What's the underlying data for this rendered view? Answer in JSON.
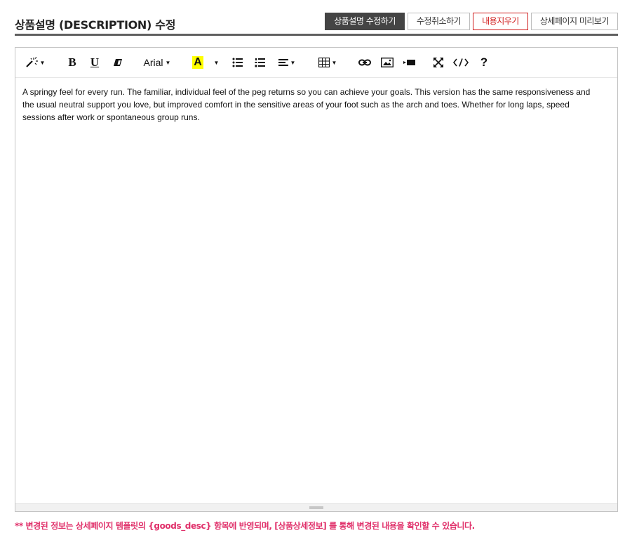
{
  "header": {
    "title": "상품설명 (DESCRIPTION) 수정",
    "buttons": {
      "save": "상품설명 수정하기",
      "cancel": "수정취소하기",
      "clear": "내용지우기",
      "preview": "상세페이지 미리보기"
    }
  },
  "toolbar": {
    "font_name": "Arial",
    "highlight_letter": "A",
    "bold": "B",
    "underline": "U",
    "help": "?",
    "icons": [
      "magic-icon",
      "bold-icon",
      "underline-icon",
      "eraser-icon",
      "font-family-dropdown",
      "font-color-icon",
      "bullet-list-icon",
      "numbered-list-icon",
      "align-icon",
      "table-icon",
      "link-icon",
      "image-icon",
      "video-icon",
      "fullscreen-icon",
      "code-view-icon",
      "help-icon"
    ],
    "highlight_color": "#ffff00"
  },
  "editor": {
    "content": "A springy feel for every run. The familiar, individual feel of the peg returns so you can achieve your goals. This version has the same responsiveness and the usual neutral support you love, but improved comfort in the sensitive areas of your foot such as the arch and toes. Whether for long laps, speed sessions after work or spontaneous group runs."
  },
  "notice": {
    "text": "** 변경된 정보는 상세페이지 템플릿의 {goods_desc} 항목에 반영되며, [상품상세정보] 를 통해 변경된 내용을 확인할 수 있습니다."
  },
  "colors": {
    "dark_button": "#444444",
    "clear_button": "#d01c1c",
    "notice": "#e0306a"
  }
}
